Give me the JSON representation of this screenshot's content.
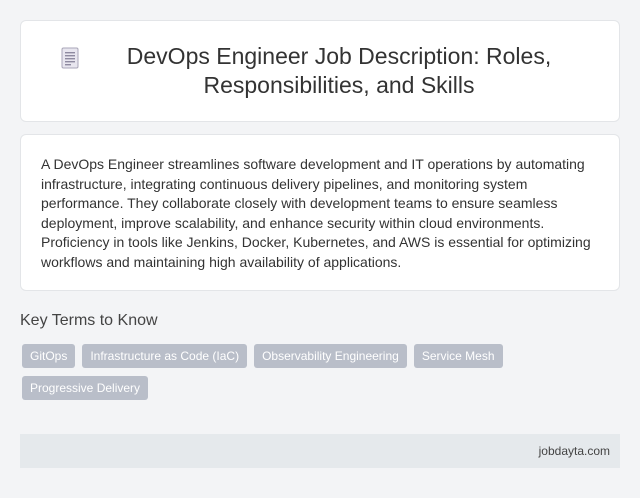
{
  "header": {
    "icon": "document-icon",
    "title": "DevOps Engineer Job Description: Roles, Responsibilities, and Skills"
  },
  "description": {
    "text": "A DevOps Engineer streamlines software development and IT operations by automating infrastructure, integrating continuous delivery pipelines, and monitoring system performance. They collaborate closely with development teams to ensure seamless deployment, improve scalability, and enhance security within cloud environments. Proficiency in tools like Jenkins, Docker, Kubernetes, and AWS is essential for optimizing workflows and maintaining high availability of applications."
  },
  "key_terms": {
    "heading": "Key Terms to Know",
    "tags": [
      "GitOps",
      "Infrastructure as Code (IaC)",
      "Observability Engineering",
      "Service Mesh",
      "Progressive Delivery"
    ]
  },
  "footer": {
    "source": "jobdayta.com"
  },
  "colors": {
    "tag_background": "#b9bec9",
    "page_background": "#f3f4f6",
    "footer_background": "#e5e9ec"
  }
}
